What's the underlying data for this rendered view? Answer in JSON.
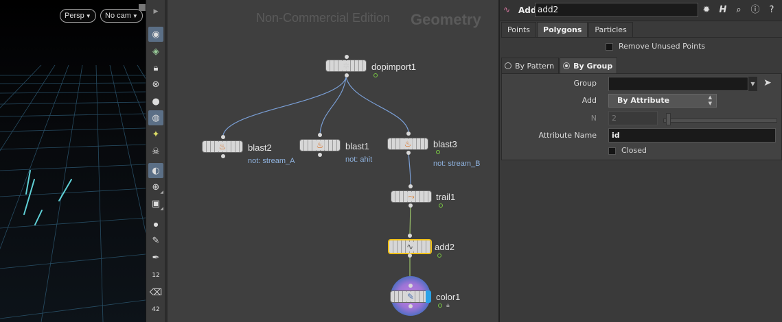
{
  "viewport": {
    "camera_button": "Persp",
    "cam_select": "No cam",
    "colors": {
      "grid": "#2f5d78",
      "particles": "#5fd0d6"
    }
  },
  "toolbar": {
    "tools": [
      "eye-icon",
      "shaded-eye-icon",
      "lock-icon",
      "close-circle-icon",
      "sphere-icon",
      "bulb-icon",
      "bulb-small-icon",
      "skull-icon",
      "film-icon",
      "lens-icon",
      "camera-icon",
      "dot-icon",
      "brush-icon",
      "pen-icon",
      "points-number-icon",
      "eraser-icon",
      "prims-number-icon"
    ],
    "number_badge_1": "12",
    "number_badge_2": "42"
  },
  "network": {
    "edition": "Non-Commercial Edition",
    "context": "Geometry",
    "nodes": [
      {
        "name": "dopimport1",
        "comment": "",
        "icon": "dop-import-icon"
      },
      {
        "name": "blast2",
        "comment": "not: stream_A",
        "icon": "blast-icon"
      },
      {
        "name": "blast1",
        "comment": "not: ahit",
        "icon": "blast-icon"
      },
      {
        "name": "blast3",
        "comment": "not: stream_B",
        "icon": "blast-icon"
      },
      {
        "name": "trail1",
        "comment": "",
        "icon": "trail-icon"
      },
      {
        "name": "add2",
        "comment": "",
        "icon": "add-icon"
      },
      {
        "name": "color1",
        "comment": "",
        "icon": "color-icon"
      }
    ],
    "selected_node": "add2",
    "display_node": "color1",
    "colors": {
      "wire_blue": "#7a9fd6",
      "wire_green": "#9bc36a",
      "selected": "#f2c118",
      "display_flag": "#2aa2e8"
    }
  },
  "params": {
    "op_type": "Add",
    "node_name": "add2",
    "header_icons": [
      "gear-icon",
      "houdini-h-icon",
      "search-icon",
      "info-icon",
      "help-icon"
    ],
    "tabs": [
      {
        "label": "Points",
        "active": false
      },
      {
        "label": "Polygons",
        "active": true
      },
      {
        "label": "Particles",
        "active": false
      }
    ],
    "remove_unused_points": "Remove Unused Points",
    "mode_tabs": [
      {
        "label": "By Pattern",
        "active": false
      },
      {
        "label": "By Group",
        "active": true
      }
    ],
    "group_label": "Group",
    "group_value": "",
    "add_label": "Add",
    "add_value": "By Attribute",
    "n_label": "N",
    "n_value": "2",
    "attribute_name_label": "Attribute Name",
    "attribute_name_value": "id",
    "closed_label": "Closed"
  }
}
